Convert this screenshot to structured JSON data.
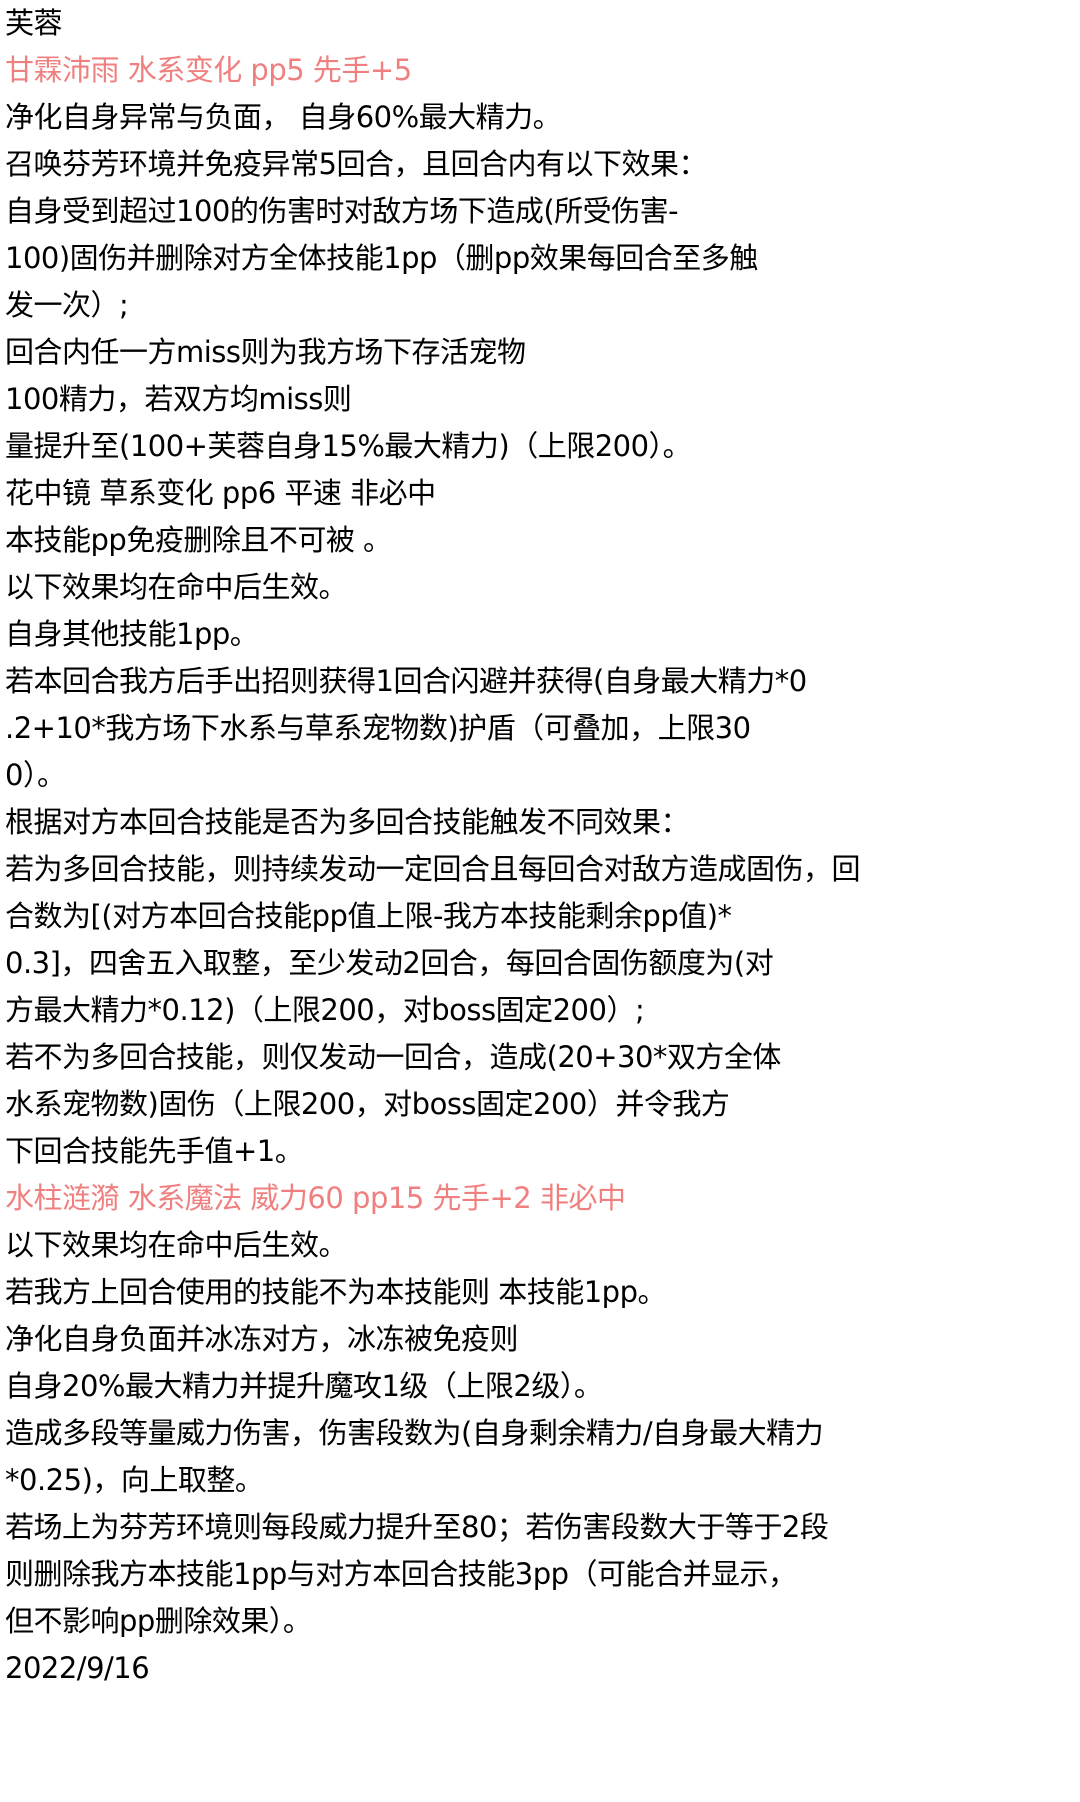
{
  "document": {
    "lines": [
      {
        "text": "芙蓉"
      },
      {
        "text": "甘霖沛雨 水系变化 pp5 先手+5",
        "style": "skill-title",
        "color": "#f08080"
      },
      {
        "text": "净化自身异常与负面， 自身60%最大精力。"
      },
      {
        "text": "召唤芬芳环境并免疫异常5回合，且回合内有以下效果："
      },
      {
        "text": "自身受到超过100的伤害时对敌方场下造成(所受伤害-"
      },
      {
        "text": "100)固伤并删除对方全体技能1pp（删pp效果每回合至多触"
      },
      {
        "text": "发一次）;"
      },
      {
        "text": "回合内任一方miss则为我方场下存活宠物"
      },
      {
        "text": "100精力，若双方均miss则"
      },
      {
        "text": "量提升至(100+芙蓉自身15%最大精力)（上限200）。"
      },
      {
        "text": "花中镜 草系变化 pp6 平速 非必中"
      },
      {
        "text": "本技能pp免疫删除且不可被 。"
      },
      {
        "text": "以下效果均在命中后生效。"
      },
      {
        "text": "自身其他技能1pp。"
      },
      {
        "text": "若本回合我方后手出招则获得1回合闪避并获得(自身最大精力*0"
      },
      {
        "text": ".2+10*我方场下水系与草系宠物数)护盾（可叠加，上限30"
      },
      {
        "text": "0）。"
      },
      {
        "text": "根据对方本回合技能是否为多回合技能触发不同效果："
      },
      {
        "text": "若为多回合技能，则持续发动一定回合且每回合对敌方造成固伤，回"
      },
      {
        "text": "合数为[(对方本回合技能pp值上限-我方本技能剩余pp值)*"
      },
      {
        "text": "0.3]，四舍五入取整，至少发动2回合，每回合固伤额度为(对"
      },
      {
        "text": "方最大精力*0.12)（上限200，对boss固定200）;"
      },
      {
        "text": "若不为多回合技能，则仅发动一回合，造成(20+30*双方全体"
      },
      {
        "text": "水系宠物数)固伤（上限200，对boss固定200）并令我方"
      },
      {
        "text": "下回合技能先手值+1。"
      },
      {
        "text": "水柱涟漪 水系魔法 威力60 pp15 先手+2 非必中",
        "style": "skill-title",
        "color": "#f08080"
      },
      {
        "text": "以下效果均在命中后生效。"
      },
      {
        "text": "若我方上回合使用的技能不为本技能则 本技能1pp。"
      },
      {
        "text": "净化自身负面并冰冻对方，冰冻被免疫则"
      },
      {
        "text": "自身20%最大精力并提升魔攻1级（上限2级）。"
      },
      {
        "text": "造成多段等量威力伤害，伤害段数为(自身剩余精力/自身最大精力"
      },
      {
        "text": "*0.25)，向上取整。"
      },
      {
        "text": "若场上为芬芳环境则每段威力提升至80；若伤害段数大于等于2段"
      },
      {
        "text": "则删除我方本技能1pp与对方本回合技能3pp（可能合并显示，"
      },
      {
        "text": "但不影响pp删除效果）。"
      },
      {
        "text": "2022/9/16"
      }
    ]
  }
}
